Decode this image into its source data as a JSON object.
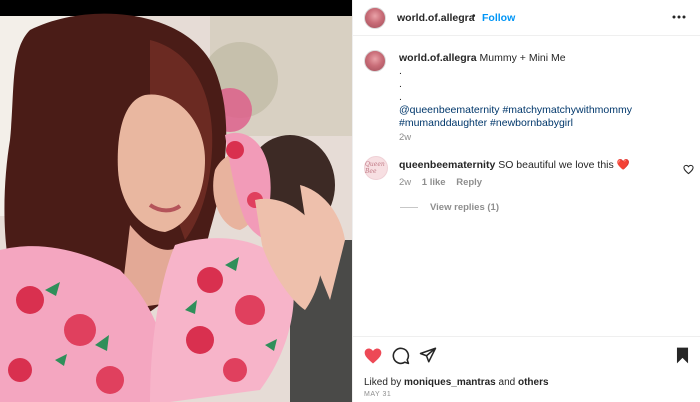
{
  "post": {
    "image_alt": "Woman in pink floral robe holding newborn in matching floral swaddle and headband",
    "header": {
      "username": "world.of.allegra",
      "separator": "•",
      "follow_label": "Follow",
      "more_label": "•••"
    },
    "caption": {
      "username": "world.of.allegra",
      "text": "Mummy + Mini Me",
      "dots": [
        ".",
        ".",
        "."
      ],
      "hashtags_line1": "@queenbeematernity #matchymatchywithmommy",
      "hashtags_line2": "#mumanddaughter #newbornbabygirl",
      "time": "2w"
    },
    "comment": {
      "avatar_text": "Queen Bee",
      "username": "queenbeematernity",
      "text": "SO beautiful we love this ❤️",
      "time": "2w",
      "likes": "1 like",
      "reply_label": "Reply",
      "view_replies": "View replies (1)"
    },
    "footer": {
      "liked_by_prefix": "Liked by",
      "liked_by_user": "moniques_mantras",
      "liked_by_and": "and",
      "liked_by_others": "others",
      "date": "MAY 31"
    }
  },
  "colors": {
    "accent": "#0095f6",
    "like_red": "#ed4956",
    "hashtag": "#00376b",
    "muted": "#8e8e8e"
  },
  "icons": [
    "more-icon",
    "heart-icon",
    "comment-icon",
    "share-icon",
    "bookmark-icon",
    "comment-like-icon"
  ]
}
